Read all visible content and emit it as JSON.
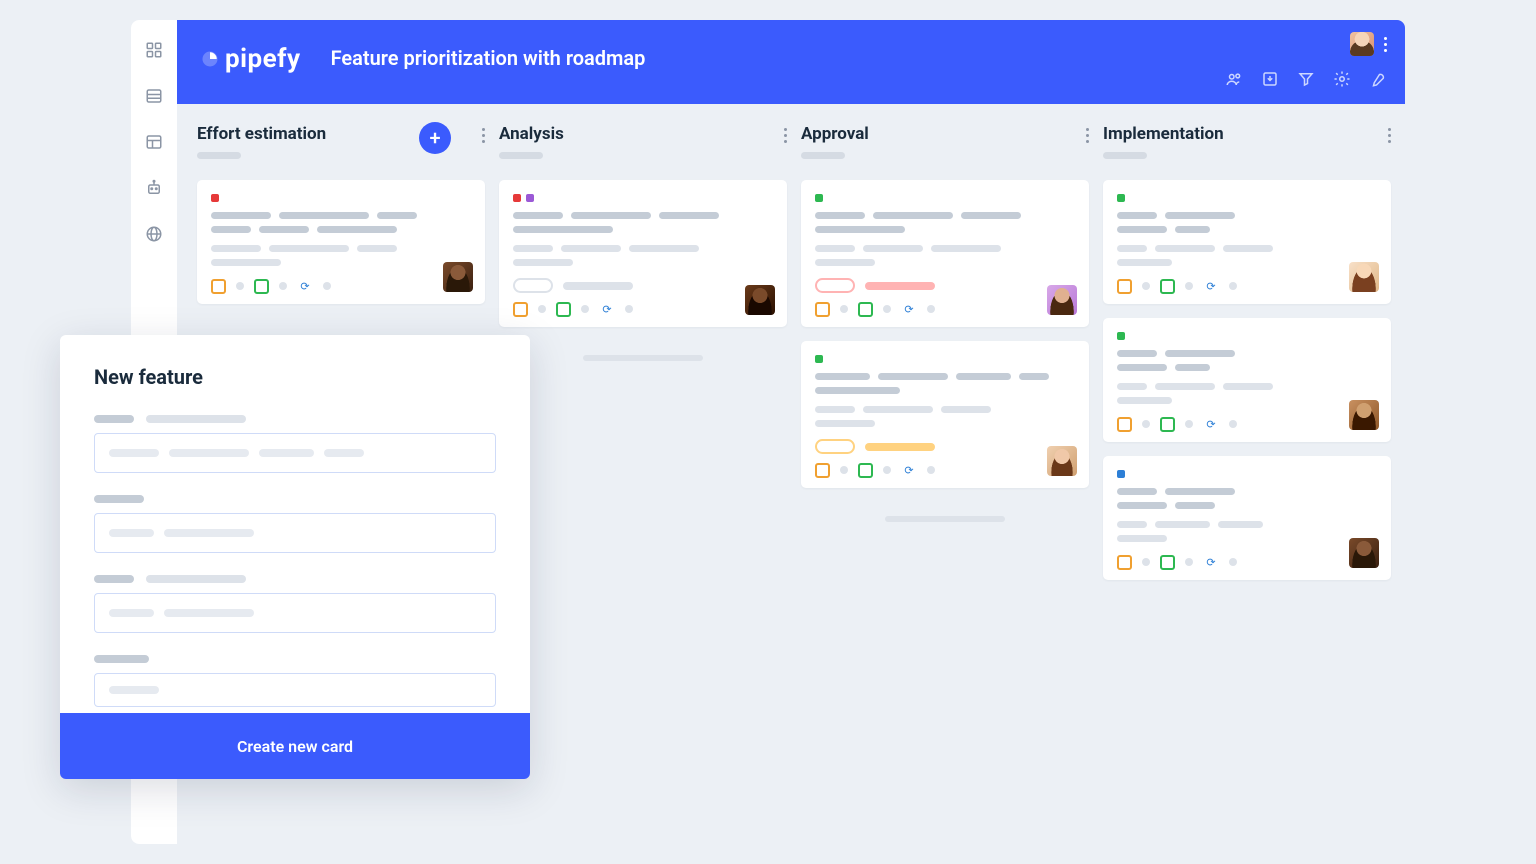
{
  "header": {
    "brand": "pipefy",
    "title": "Feature prioritization with roadmap"
  },
  "columns": [
    {
      "title": "Effort estimation",
      "has_add": true
    },
    {
      "title": "Analysis",
      "has_add": false
    },
    {
      "title": "Approval",
      "has_add": false
    },
    {
      "title": "Implementation",
      "has_add": false
    }
  ],
  "modal": {
    "title": "New feature",
    "submit_label": "Create new card"
  },
  "toolbar_icons": [
    "team-icon",
    "import-icon",
    "filter-icon",
    "settings-icon",
    "wrench-icon"
  ],
  "rail_icons": [
    "apps-icon",
    "list-icon",
    "layout-icon",
    "bot-icon",
    "globe-icon"
  ]
}
